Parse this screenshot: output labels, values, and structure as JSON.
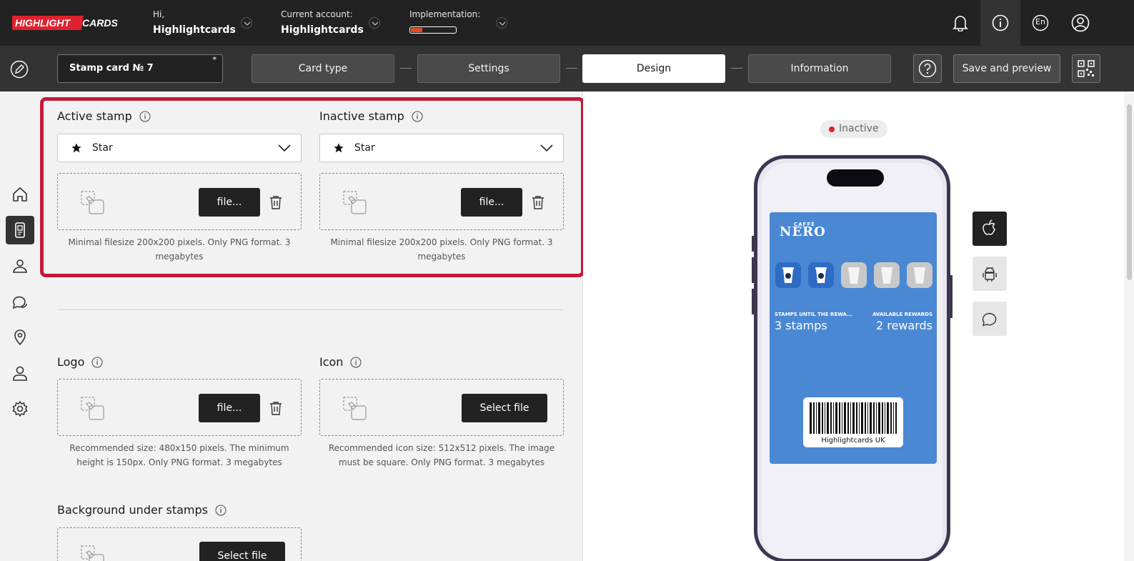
{
  "header": {
    "brand": "HIGHLIGHTCARDS",
    "greeting_label": "Hi,",
    "greeting_name": "Highlightcards",
    "account_label": "Current account:",
    "account_name": "Highlightcards",
    "implementation_label": "Implementation:",
    "implementation_progress": 0.25,
    "language": "En"
  },
  "toolbar": {
    "card_name": "Stamp card № 7",
    "card_name_marker": "*",
    "steps": [
      {
        "label": "Card type",
        "active": false
      },
      {
        "label": "Settings",
        "active": false
      },
      {
        "label": "Design",
        "active": true
      },
      {
        "label": "Information",
        "active": false
      }
    ],
    "save_label": "Save and preview"
  },
  "sidebar": {
    "items": [
      {
        "icon": "home-icon",
        "active": false
      },
      {
        "icon": "cards-icon",
        "active": true
      },
      {
        "icon": "clients-icon",
        "active": false
      },
      {
        "icon": "messages-icon",
        "active": false
      },
      {
        "icon": "location-icon",
        "active": false
      },
      {
        "icon": "user-icon",
        "active": false
      },
      {
        "icon": "settings-icon",
        "active": false
      }
    ]
  },
  "form": {
    "active_stamp": {
      "label": "Active stamp",
      "selected": "Star",
      "file_button": "file...",
      "hint": "Minimal filesize 200x200 pixels. Only PNG format. 3 megabytes"
    },
    "inactive_stamp": {
      "label": "Inactive stamp",
      "selected": "Star",
      "file_button": "file...",
      "hint": "Minimal filesize 200x200 pixels. Only PNG format. 3 megabytes"
    },
    "logo": {
      "label": "Logo",
      "file_button": "file...",
      "hint": "Recommended size: 480x150 pixels. The minimum height is 150px. Only PNG format. 3 megabytes"
    },
    "icon": {
      "label": "Icon",
      "file_button": "Select file",
      "hint": "Recommended icon size: 512x512 pixels. The image must be square. Only PNG format. 3 megabytes"
    },
    "background": {
      "label": "Background under stamps",
      "file_button": "Select file"
    }
  },
  "preview": {
    "status": "Inactive",
    "status_color": "#e01e2e",
    "card": {
      "brand_small": "CAFFÈ",
      "brand": "NERO",
      "background_color": "#4a88d4",
      "stamps_total": 5,
      "stamps_active": 2,
      "left_label": "STAMPS UNTIL THE REWA...",
      "left_value": "3 stamps",
      "right_label": "AVAILABLE REWARDS",
      "right_value": "2 rewards",
      "barcode_text": "Highlightcards UK"
    },
    "platforms": [
      {
        "icon": "apple-icon",
        "active": true
      },
      {
        "icon": "android-icon",
        "active": false
      },
      {
        "icon": "chat-icon",
        "active": false
      }
    ]
  },
  "colors": {
    "accent_highlight": "#c4183c",
    "header_bg": "#222222",
    "toolbar_bg": "#333333",
    "progress": "#e24b1d"
  }
}
